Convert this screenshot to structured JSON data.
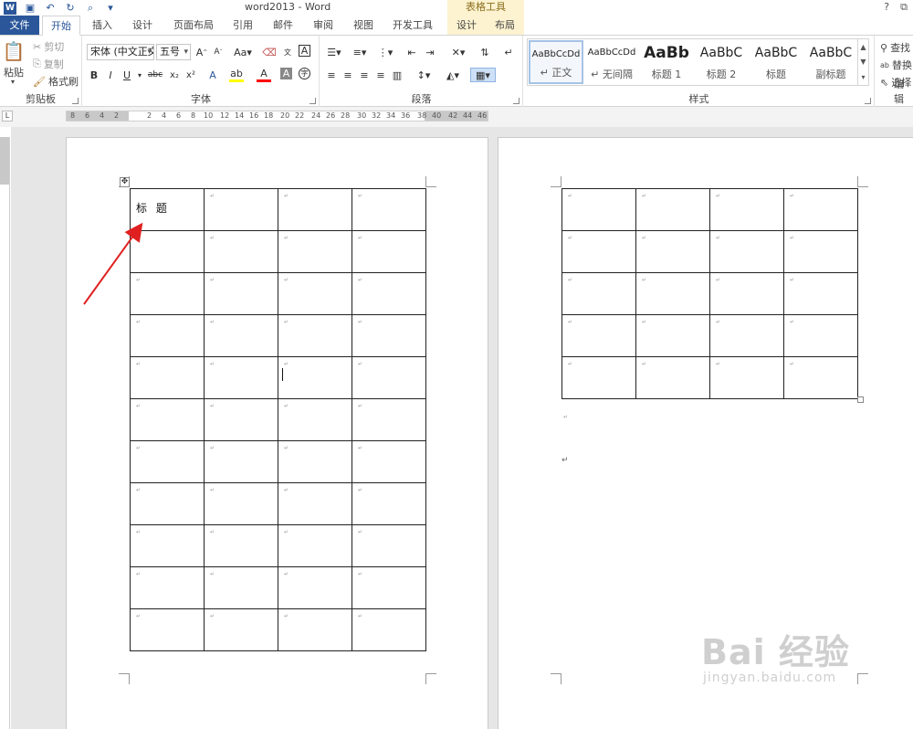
{
  "window": {
    "title": "word2013 - Word",
    "context_group": "表格工具",
    "help": "?",
    "restore": "⧉"
  },
  "tabs": [
    {
      "label": "文件"
    },
    {
      "label": "开始"
    },
    {
      "label": "插入"
    },
    {
      "label": "设计"
    },
    {
      "label": "页面布局"
    },
    {
      "label": "引用"
    },
    {
      "label": "邮件"
    },
    {
      "label": "审阅"
    },
    {
      "label": "视图"
    },
    {
      "label": "开发工具"
    },
    {
      "label": "设计"
    },
    {
      "label": "布局"
    }
  ],
  "ribbon": {
    "clipboard": {
      "label": "剪贴板",
      "paste": "粘贴",
      "cut": "剪切",
      "copy": "复制",
      "format_painter": "格式刷"
    },
    "font": {
      "label": "字体",
      "font_name": "宋体 (中文正文",
      "font_size": "五号"
    },
    "paragraph": {
      "label": "段落"
    },
    "styles": {
      "label": "样式",
      "items": [
        {
          "sample": "AaBbCcDd",
          "name": "↵ 正文"
        },
        {
          "sample": "AaBbCcDd",
          "name": "↵ 无间隔"
        },
        {
          "sample": "AaBb",
          "name": "标题 1"
        },
        {
          "sample": "AaBbC",
          "name": "标题 2"
        },
        {
          "sample": "AaBbC",
          "name": "标题"
        },
        {
          "sample": "AaBbC",
          "name": "副标题"
        }
      ]
    },
    "editing": {
      "label": "编辑",
      "find": "查找",
      "replace": "替换",
      "select": "选择"
    }
  },
  "ruler": {
    "numbers": [
      "8",
      "6",
      "4",
      "2",
      "2",
      "4",
      "6",
      "8",
      "10",
      "12",
      "14",
      "16",
      "18",
      "20",
      "22",
      "24",
      "26",
      "28",
      "30",
      "32",
      "34",
      "36",
      "38",
      "40",
      "42",
      "44",
      "46"
    ]
  },
  "document": {
    "title_cell_text": "标 题",
    "cell_mark": "↵",
    "paragraph_mark": "↵"
  },
  "watermark": {
    "logo": "Bai 经验",
    "url": "jingyan.baidu.com"
  }
}
